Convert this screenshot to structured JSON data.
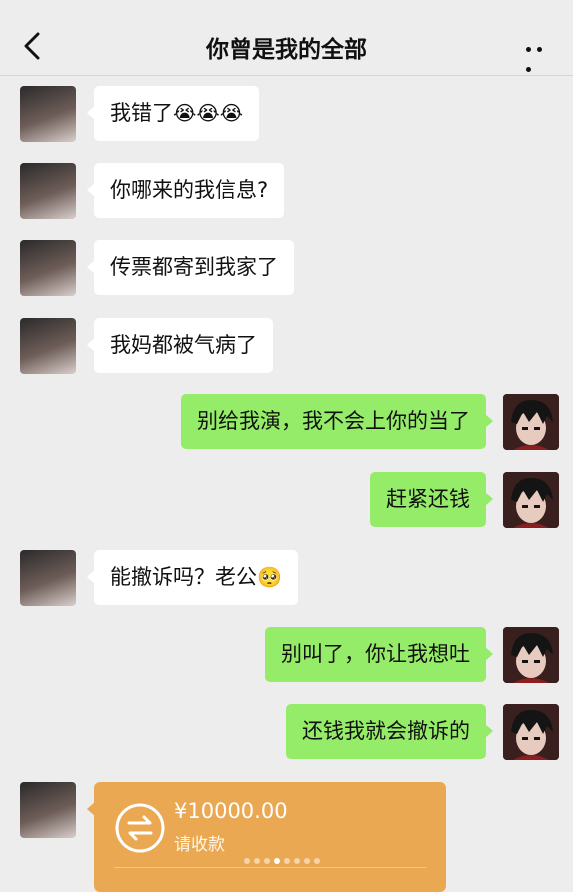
{
  "header": {
    "title": "你曾是我的全部",
    "back_icon": "chevron-left-icon",
    "more_icon": "more-icon"
  },
  "messages": [
    {
      "side": "left",
      "text": "我错了",
      "emoji": "😭😭😭"
    },
    {
      "side": "left",
      "text": "你哪来的我信息?"
    },
    {
      "side": "left",
      "text": "传票都寄到我家了"
    },
    {
      "side": "left",
      "text": "我妈都被气病了"
    },
    {
      "side": "right",
      "text": "别给我演，我不会上你的当了"
    },
    {
      "side": "right",
      "text": "赶紧还钱"
    },
    {
      "side": "left",
      "text": "能撤诉吗？老公",
      "emoji": "🥺"
    },
    {
      "side": "right",
      "text": "别叫了，你让我想吐"
    },
    {
      "side": "right",
      "text": "还钱我就会撤诉的"
    }
  ],
  "transfer": {
    "amount": "¥10000.00",
    "subtitle": "请收款",
    "icon": "transfer-icon"
  },
  "colors": {
    "background": "#ededed",
    "bubble_left": "#ffffff",
    "bubble_right": "#95ec69",
    "transfer": "#eba852"
  }
}
